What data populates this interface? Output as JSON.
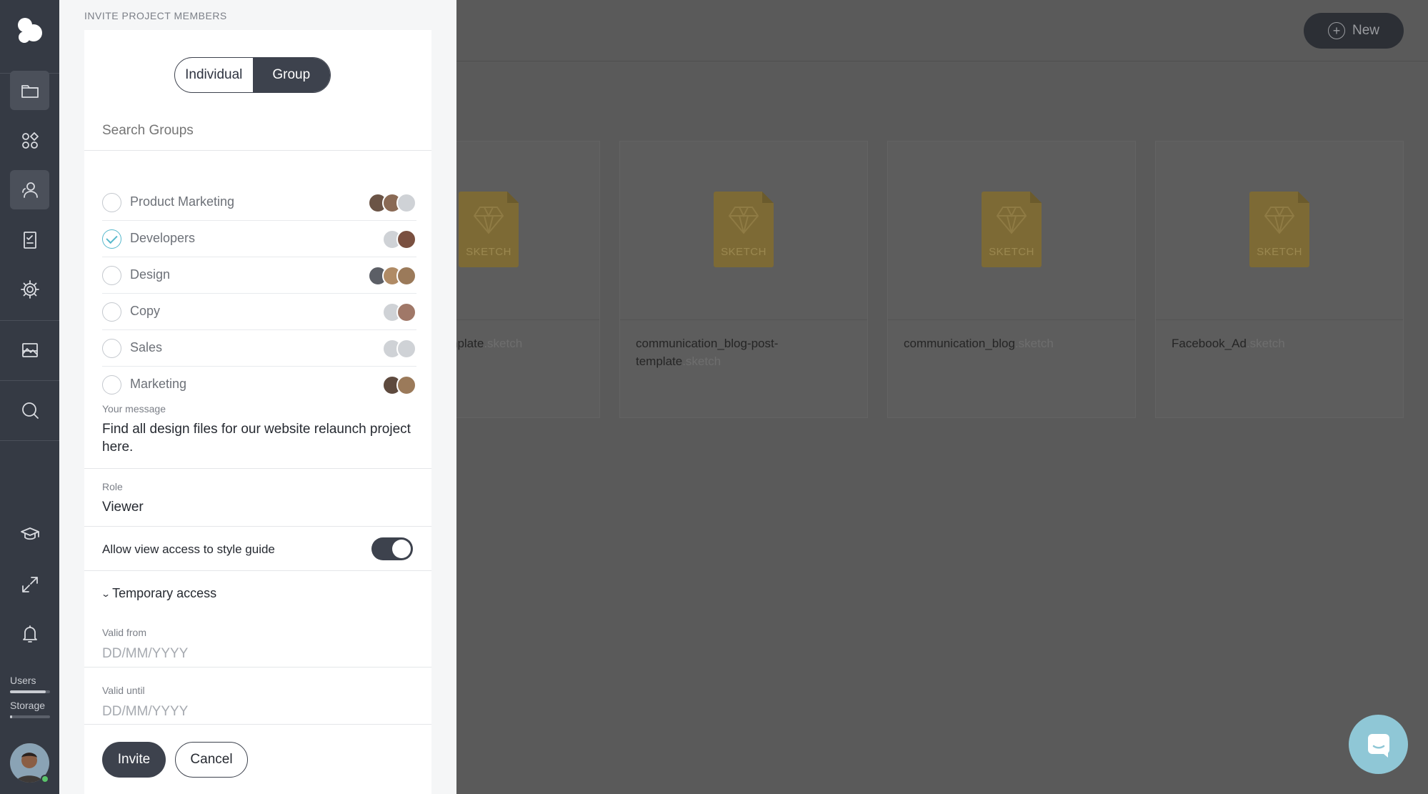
{
  "app": {
    "brand_color": "#353a44",
    "accent": "#56b8cc"
  },
  "rail": {
    "nav": [
      "folder-icon",
      "apps-icon",
      "users-icon",
      "checklist-icon",
      "settings-icon",
      "gallery-icon",
      "search-icon"
    ],
    "bottom": [
      "learn-icon",
      "expand-icon",
      "bell-icon"
    ],
    "usage": [
      {
        "label": "Users",
        "fraction": 0.9
      },
      {
        "label": "Storage",
        "fraction": 0.05
      }
    ]
  },
  "toolbar": {
    "new_label": "New"
  },
  "files": [
    {
      "name": "nplate",
      "ext": ".sketch",
      "badge": "SKETCH"
    },
    {
      "name": "communication_blog-post-template",
      "ext": ".sketch",
      "badge": "SKETCH"
    },
    {
      "name": "communication_blog",
      "ext": ".sketch",
      "badge": "SKETCH"
    },
    {
      "name": "Facebook_Ad",
      "ext": ".sketch",
      "badge": "SKETCH"
    }
  ],
  "invite": {
    "title": "INVITE PROJECT MEMBERS",
    "mode": {
      "options": [
        "Individual",
        "Group"
      ],
      "selected": "Group"
    },
    "search_placeholder": "Search Groups",
    "groups": [
      {
        "name": "Product Marketing",
        "checked": false,
        "avatars": [
          "#6b5446",
          "#8a6a55",
          "#cfd2d6"
        ]
      },
      {
        "name": "Developers",
        "checked": true,
        "avatars": [
          "#cfd2d6",
          "#7a5040"
        ]
      },
      {
        "name": "Design",
        "checked": false,
        "avatars": [
          "#5c5f66",
          "#b08b65",
          "#9b7a5a"
        ]
      },
      {
        "name": "Copy",
        "checked": false,
        "avatars": [
          "#cfd2d6",
          "#a07868"
        ]
      },
      {
        "name": "Sales",
        "checked": false,
        "avatars": [
          "#cfd2d6",
          "#cfd2d6"
        ]
      },
      {
        "name": "Marketing",
        "checked": false,
        "avatars": [
          "#5e4a3e",
          "#9b7a5a"
        ]
      }
    ],
    "message_label": "Your message",
    "message_value": "Find all design files for our website relaunch project here.",
    "role_label": "Role",
    "role_value": "Viewer",
    "style_guide_label": "Allow view access to style guide",
    "style_guide_enabled": true,
    "temporary_label": "Temporary access",
    "valid_from_label": "Valid from",
    "valid_from_placeholder": "DD/MM/YYYY",
    "valid_until_label": "Valid until",
    "valid_until_placeholder": "DD/MM/YYYY",
    "invite_label": "Invite",
    "cancel_label": "Cancel"
  }
}
